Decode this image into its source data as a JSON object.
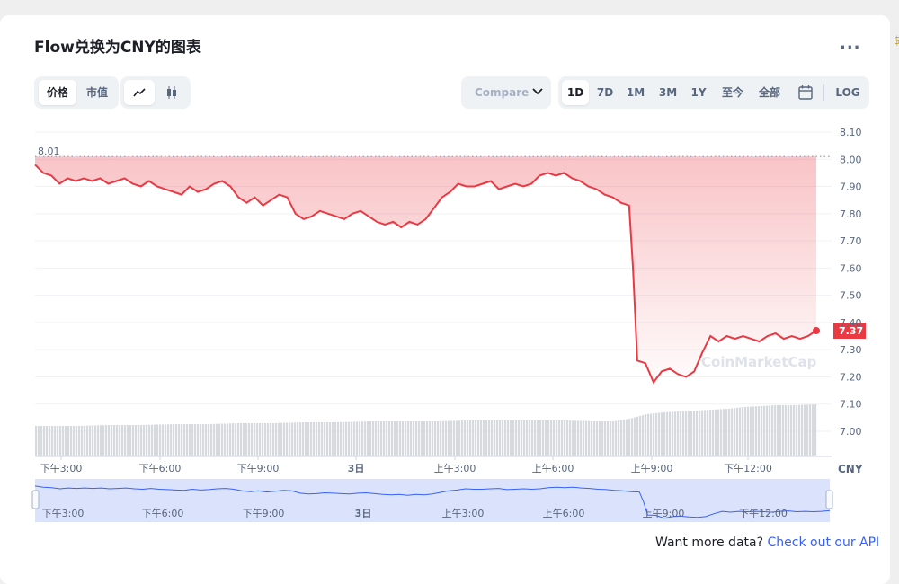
{
  "title": "Flow兑换为CNY的图表",
  "more_label": "...",
  "toggle": {
    "price": "价格",
    "mcap": "市值"
  },
  "chart_icons": [
    "line-chart-icon",
    "candlestick-icon"
  ],
  "compare": {
    "label": "Compare"
  },
  "ranges": [
    "1D",
    "7D",
    "1M",
    "3M",
    "1Y",
    "至今",
    "全部"
  ],
  "active_range": "1D",
  "log_label": "LOG",
  "watermark": "CoinMarketCap",
  "currency": "CNY",
  "footer": {
    "text": "Want more data?",
    "link": "Check out our API"
  },
  "colors": {
    "line": "#ea3943",
    "accent": "#3861fb",
    "volume": "#d6d9de",
    "navigator": "#dbe3fc"
  },
  "chart_data": {
    "type": "area",
    "title": "",
    "xlabel": "",
    "ylabel": "",
    "ylim": [
      6.94,
      8.16
    ],
    "y_ticks": [
      "8.10",
      "8.00",
      "7.90",
      "7.80",
      "7.70",
      "7.60",
      "7.50",
      "7.40",
      "7.30",
      "7.20",
      "7.10",
      "7.00"
    ],
    "x_ticks": [
      "下午3:00",
      "下午6:00",
      "下午9:00",
      "3日",
      "上午3:00",
      "上午6:00",
      "上午9:00",
      "下午12:00"
    ],
    "x_tick_hours": [
      0,
      3,
      6,
      9,
      12,
      15,
      18,
      21
    ],
    "reference_label": "8.01",
    "reference_value": 8.01,
    "last_price": 7.37,
    "last_price_label": "7.37",
    "series": [
      {
        "x": [
          -0.25,
          0.0,
          0.25,
          0.5,
          0.75,
          1.0,
          1.25,
          1.5,
          1.75,
          2.0,
          2.25,
          2.5,
          2.75,
          3.0,
          3.25,
          3.5,
          3.75,
          4.0,
          4.25,
          4.5,
          4.75,
          5.0,
          5.25,
          5.5,
          5.75,
          6.0,
          6.25,
          6.5,
          6.75,
          7.0,
          7.25,
          7.5,
          7.75,
          8.0,
          8.25,
          8.5,
          8.75,
          9.0,
          9.25,
          9.5,
          9.75,
          10.0,
          10.25,
          10.5,
          10.75,
          11.0,
          11.25,
          11.5,
          11.75,
          12.0,
          12.25,
          12.5,
          12.75,
          13.0,
          13.25,
          13.5,
          13.75,
          14.0,
          14.25,
          14.5,
          14.75,
          15.0,
          15.25,
          15.5,
          15.75,
          16.0,
          16.25,
          16.5,
          16.75,
          17.0,
          17.25,
          17.5,
          17.75,
          18.0,
          18.12,
          18.25,
          18.5,
          18.75,
          19.0,
          19.25,
          19.5,
          19.75,
          20.0,
          20.25,
          20.5,
          20.75,
          21.0,
          21.25,
          21.5,
          21.75,
          22.0,
          22.25,
          22.5,
          22.75,
          23.0,
          23.25,
          23.5,
          23.75
        ],
        "values": [
          7.98,
          7.95,
          7.94,
          7.91,
          7.93,
          7.92,
          7.93,
          7.92,
          7.93,
          7.91,
          7.92,
          7.93,
          7.91,
          7.9,
          7.92,
          7.9,
          7.89,
          7.88,
          7.87,
          7.9,
          7.88,
          7.89,
          7.91,
          7.92,
          7.9,
          7.86,
          7.84,
          7.86,
          7.83,
          7.85,
          7.87,
          7.86,
          7.8,
          7.78,
          7.79,
          7.81,
          7.8,
          7.79,
          7.78,
          7.8,
          7.81,
          7.79,
          7.77,
          7.76,
          7.77,
          7.75,
          7.77,
          7.76,
          7.78,
          7.82,
          7.86,
          7.88,
          7.91,
          7.9,
          7.9,
          7.91,
          7.92,
          7.89,
          7.9,
          7.91,
          7.9,
          7.91,
          7.94,
          7.95,
          7.94,
          7.95,
          7.93,
          7.92,
          7.9,
          7.89,
          7.87,
          7.86,
          7.84,
          7.83,
          7.6,
          7.26,
          7.25,
          7.18,
          7.22,
          7.23,
          7.21,
          7.2,
          7.22,
          7.29,
          7.35,
          7.33,
          7.35,
          7.34,
          7.35,
          7.34,
          7.33,
          7.35,
          7.36,
          7.34,
          7.35,
          7.34,
          7.35,
          7.37
        ]
      }
    ],
    "volume": {
      "x": [
        -0.25,
        1,
        2,
        3,
        4,
        5,
        6,
        7,
        8,
        9,
        10,
        11,
        12,
        13,
        14,
        15,
        16,
        17,
        17.5,
        18,
        18.5,
        19,
        19.5,
        20,
        20.5,
        21,
        21.5,
        22,
        22.5,
        23,
        23.75
      ],
      "values": [
        33,
        33,
        34,
        34,
        35,
        35,
        36,
        36,
        37,
        37,
        38,
        38,
        38,
        39,
        39,
        39,
        39,
        38,
        38,
        41,
        46,
        48,
        49,
        50,
        51,
        52,
        54,
        55,
        56,
        56,
        57
      ]
    },
    "navigator_ticks": [
      "下午3:00",
      "下午6:00",
      "下午9:00",
      "3日",
      "上午3:00",
      "上午6:00",
      "上午9:00",
      "下午12:00"
    ]
  }
}
